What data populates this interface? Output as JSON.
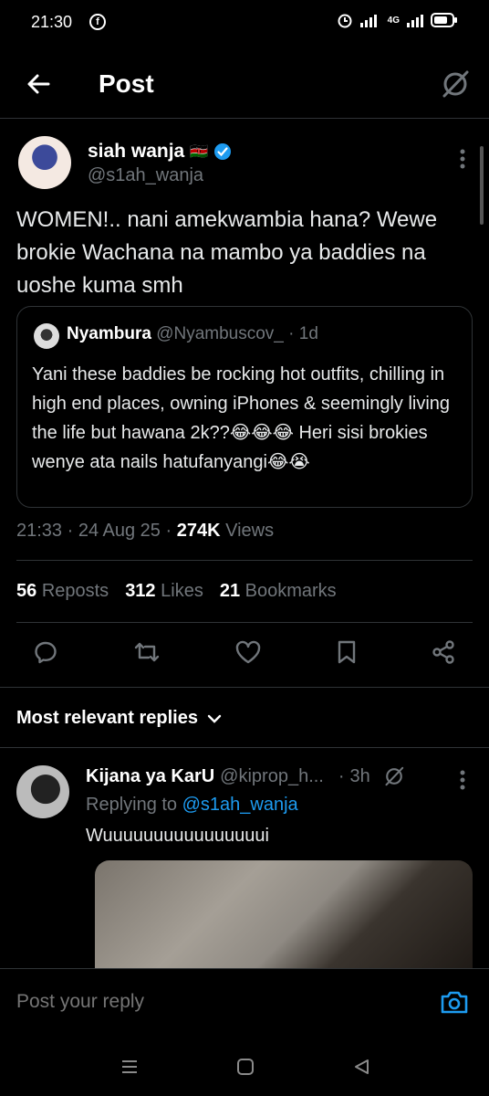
{
  "status": {
    "time": "21:30",
    "network": "4G"
  },
  "header": {
    "title": "Post"
  },
  "author": {
    "name": "siah wanja",
    "flag": "🇰🇪",
    "handle": "@s1ah_wanja"
  },
  "post": {
    "text": "WOMEN!.. nani amekwambia hana? Wewe brokie Wachana na mambo ya baddies na uoshe kuma smh",
    "time": "21:33",
    "date": "24 Aug 25",
    "views_count": "274K",
    "views_label": "Views"
  },
  "quote": {
    "name": "Nyambura",
    "handle": "@Nyambuscov_",
    "age": "1d",
    "text": "Yani these baddies be rocking hot outfits, chilling in high end places, owning iPhones & seemingly living the life but hawana 2k??😂😂😂 Heri sisi brokies wenye ata nails hatufanyangi😂😭"
  },
  "stats": {
    "reposts_count": "56",
    "reposts_label": "Reposts",
    "likes_count": "312",
    "likes_label": "Likes",
    "bookmarks_count": "21",
    "bookmarks_label": "Bookmarks"
  },
  "replies_section": {
    "sort_label": "Most relevant replies"
  },
  "reply": {
    "name": "Kijana ya KarU",
    "handle": "@kiprop_h...",
    "age": "3h",
    "replying_prefix": "Replying to",
    "replying_handle": "@s1ah_wanja",
    "text": "Wuuuuuuuuuuuuuuuui"
  },
  "composer": {
    "placeholder": "Post your reply"
  },
  "colors": {
    "accent": "#1d9bf0",
    "background": "#000000",
    "muted": "#71767b",
    "divider": "#2f3336"
  }
}
